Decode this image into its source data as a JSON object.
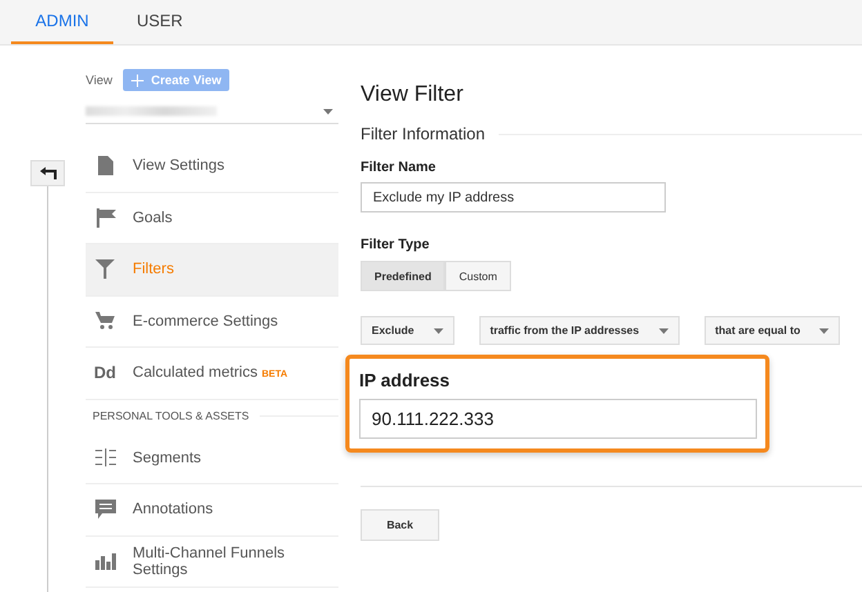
{
  "tabs": [
    {
      "label": "ADMIN",
      "selected": true
    },
    {
      "label": "USER",
      "selected": false
    }
  ],
  "view": {
    "label": "View",
    "create_button": "Create View"
  },
  "sidebar": {
    "sections": [
      {
        "items": [
          {
            "label": "View Settings",
            "selected": false
          },
          {
            "label": "Goals",
            "selected": false
          },
          {
            "label": "Filters",
            "selected": true
          },
          {
            "label": "E-commerce Settings",
            "selected": false
          },
          {
            "label": "Calculated metrics",
            "icon_text": "Dd",
            "badge": "BETA",
            "selected": false
          }
        ]
      },
      {
        "title": "PERSONAL TOOLS & ASSETS",
        "items": [
          {
            "label": "Segments",
            "selected": false
          },
          {
            "label": "Annotations",
            "selected": false
          },
          {
            "label": "Multi-Channel Funnels Settings",
            "selected": false
          }
        ]
      }
    ]
  },
  "content": {
    "title": "View Filter",
    "section": "Filter Information",
    "filter_name": {
      "label": "Filter Name",
      "value": "Exclude my IP address"
    },
    "filter_type": {
      "label": "Filter Type",
      "options": [
        {
          "label": "Predefined",
          "selected": true
        },
        {
          "label": "Custom",
          "selected": false
        }
      ]
    },
    "dropdowns": [
      "Exclude",
      "traffic from the IP addresses",
      "that are equal to"
    ],
    "ip": {
      "label": "IP address",
      "value": "90.111.222.333"
    },
    "buttons": [
      "Back"
    ]
  }
}
